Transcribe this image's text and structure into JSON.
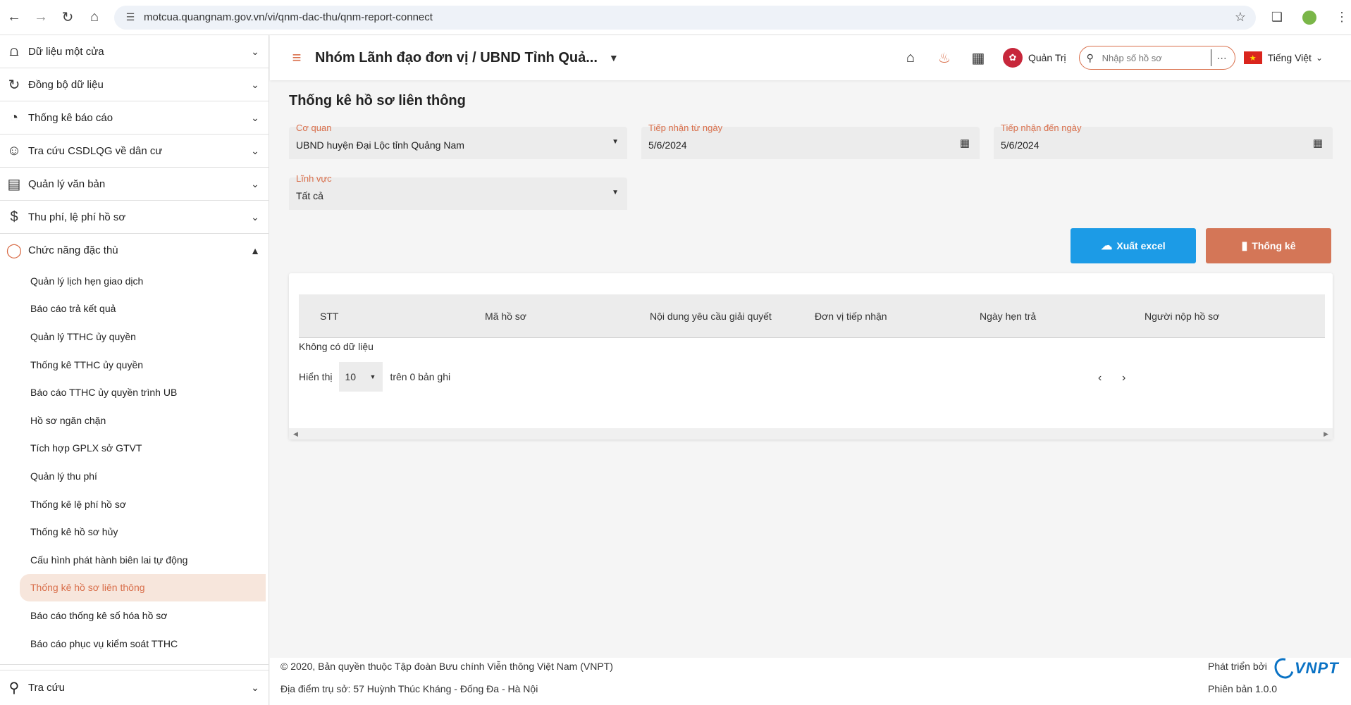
{
  "browser": {
    "url": "motcua.quangnam.gov.vn/vi/qnm-dac-thu/qnm-report-connect"
  },
  "sidebar": {
    "groups": [
      {
        "label": "Dữ liệu một cửa",
        "icon": "hierarchy-icon"
      },
      {
        "label": "Đồng bộ dữ liệu",
        "icon": "sync-icon"
      },
      {
        "label": "Thống kê báo cáo",
        "icon": "pie-chart-icon"
      },
      {
        "label": "Tra cứu CSDLQG về dân cư",
        "icon": "people-icon"
      },
      {
        "label": "Quản lý văn bản",
        "icon": "pdf-icon"
      },
      {
        "label": "Thu phí, lệ phí hồ sơ",
        "icon": "dollar-icon"
      }
    ],
    "special": {
      "label": "Chức năng đặc thù",
      "icon": "loading-circle-icon",
      "items": [
        "Quản lý lịch hẹn giao dịch",
        "Báo cáo trả kết quả",
        "Quản lý TTHC ủy quyền",
        "Thống kê TTHC ủy quyền",
        "Báo cáo TTHC ủy quyền trình UB",
        "Hồ sơ ngăn chặn",
        "Tích hợp GPLX sở GTVT",
        "Quản lý thu phí",
        "Thống kê lệ phí hồ sơ",
        "Thống kê hồ sơ hủy",
        "Cấu hình phát hành biên lai tự động",
        "Thống kê hồ sơ liên thông",
        "Báo cáo thống kê số hóa hồ sơ",
        "Báo cáo phục vụ kiểm soát TTHC"
      ],
      "active_index": 11
    },
    "bottom": {
      "label": "Tra cứu",
      "icon": "search-icon"
    }
  },
  "header": {
    "unit_title": "Nhóm Lãnh đạo đơn vị / UBND Tỉnh Quả...",
    "user_name": "Quản Trị",
    "search_placeholder": "Nhập số hồ sơ",
    "language": "Tiếng Việt"
  },
  "page": {
    "title": "Thống kê hồ sơ liên thông",
    "filters": {
      "agency": {
        "label": "Cơ quan",
        "value": "UBND huyện Đại Lộc tỉnh Quảng Nam"
      },
      "from_date": {
        "label": "Tiếp nhận từ ngày",
        "value": "5/6/2024"
      },
      "to_date": {
        "label": "Tiếp nhận đến ngày",
        "value": "5/6/2024"
      },
      "field": {
        "label": "Lĩnh vực",
        "value": "Tất cả"
      }
    },
    "buttons": {
      "export": "Xuất excel",
      "stat": "Thống kê"
    },
    "table": {
      "columns": [
        "STT",
        "Mã hồ sơ",
        "Nội dung yêu cầu giải quyết",
        "Đơn vị tiếp nhận",
        "Ngày hẹn trả",
        "Người nộp hồ sơ"
      ],
      "empty_text": "Không có dữ liệu",
      "show_label": "Hiển thị",
      "page_size": "10",
      "total_text": "trên 0 bản ghi"
    }
  },
  "footer": {
    "copyright": "© 2020, Bản quyền thuộc Tập đoàn Bưu chính Viễn thông Việt Nam (VNPT)",
    "address": "Địa điểm trụ sở: 57 Huỳnh Thúc Kháng - Đống Đa - Hà Nội",
    "developed_by": "Phát triển bởi",
    "brand": "VNPT",
    "version": "Phiên bản 1.0.0"
  },
  "colors": {
    "accent": "#d96f4b",
    "excel_button": "#1c9be6",
    "stat_button": "#d47657"
  }
}
